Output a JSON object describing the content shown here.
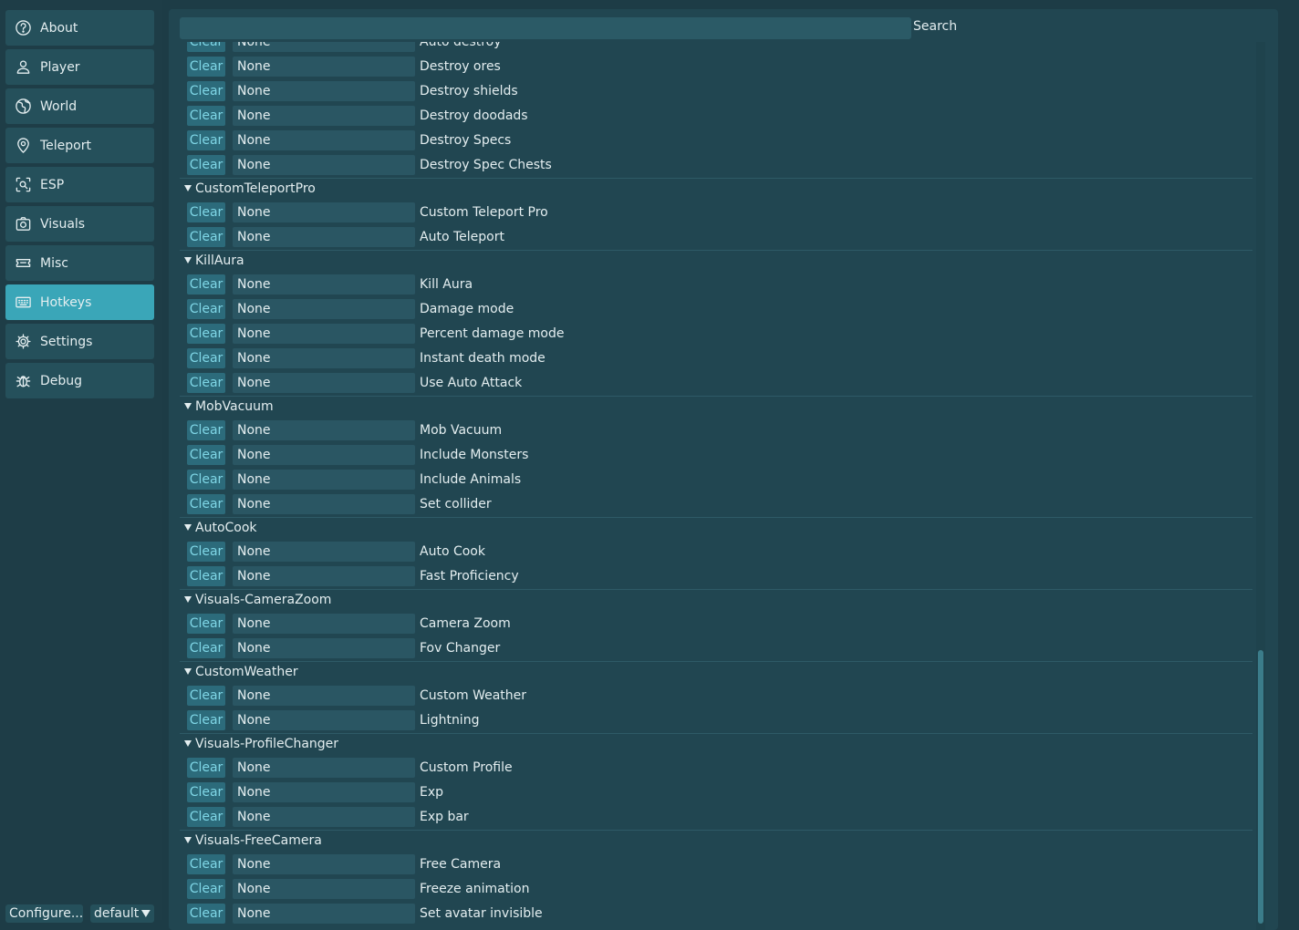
{
  "sidebar": {
    "items": [
      {
        "label": "About",
        "icon": "help-circle-icon"
      },
      {
        "label": "Player",
        "icon": "user-icon"
      },
      {
        "label": "World",
        "icon": "globe-icon"
      },
      {
        "label": "Teleport",
        "icon": "map-pin-icon"
      },
      {
        "label": "ESP",
        "icon": "scan-icon"
      },
      {
        "label": "Visuals",
        "icon": "camera-icon"
      },
      {
        "label": "Misc",
        "icon": "ticket-icon"
      },
      {
        "label": "Hotkeys",
        "icon": "keyboard-icon",
        "active": true
      },
      {
        "label": "Settings",
        "icon": "gear-icon"
      },
      {
        "label": "Debug",
        "icon": "bug-icon"
      }
    ],
    "footer": {
      "config_label": "Configure...",
      "profile_label": "default"
    }
  },
  "search": {
    "label": "Search",
    "value": ""
  },
  "colors": {
    "background": "#1d3c46",
    "panel": "#214651",
    "accent": "#3aa6b8",
    "clear_text": "#7fd6e6"
  },
  "hotkeys": {
    "clear_label": "Clear",
    "partial_top": {
      "key": "None",
      "label": "Auto destroy"
    },
    "groups": [
      {
        "title": null,
        "items": [
          {
            "key": "None",
            "label": "Destroy ores"
          },
          {
            "key": "None",
            "label": "Destroy shields"
          },
          {
            "key": "None",
            "label": "Destroy doodads"
          },
          {
            "key": "None",
            "label": "Destroy Specs"
          },
          {
            "key": "None",
            "label": "Destroy Spec Chests"
          }
        ]
      },
      {
        "title": "CustomTeleportPro",
        "items": [
          {
            "key": "None",
            "label": "Custom Teleport Pro"
          },
          {
            "key": "None",
            "label": "Auto Teleport"
          }
        ]
      },
      {
        "title": "KillAura",
        "items": [
          {
            "key": "None",
            "label": "Kill Aura"
          },
          {
            "key": "None",
            "label": "Damage mode"
          },
          {
            "key": "None",
            "label": "Percent damage mode"
          },
          {
            "key": "None",
            "label": "Instant death mode"
          },
          {
            "key": "None",
            "label": "Use Auto Attack"
          }
        ]
      },
      {
        "title": "MobVacuum",
        "items": [
          {
            "key": "None",
            "label": "Mob Vacuum"
          },
          {
            "key": "None",
            "label": "Include Monsters"
          },
          {
            "key": "None",
            "label": "Include Animals"
          },
          {
            "key": "None",
            "label": "Set collider"
          }
        ]
      },
      {
        "title": "AutoCook",
        "items": [
          {
            "key": "None",
            "label": "Auto Cook"
          },
          {
            "key": "None",
            "label": "Fast Proficiency"
          }
        ]
      },
      {
        "title": "Visuals-CameraZoom",
        "items": [
          {
            "key": "None",
            "label": "Camera Zoom"
          },
          {
            "key": "None",
            "label": "Fov Changer"
          }
        ]
      },
      {
        "title": "CustomWeather",
        "items": [
          {
            "key": "None",
            "label": "Custom Weather"
          },
          {
            "key": "None",
            "label": "Lightning"
          }
        ]
      },
      {
        "title": "Visuals-ProfileChanger",
        "items": [
          {
            "key": "None",
            "label": "Custom Profile"
          },
          {
            "key": "None",
            "label": "Exp"
          },
          {
            "key": "None",
            "label": "Exp bar"
          }
        ]
      },
      {
        "title": "Visuals-FreeCamera",
        "items": [
          {
            "key": "None",
            "label": "Free Camera"
          },
          {
            "key": "None",
            "label": "Freeze animation"
          },
          {
            "key": "None",
            "label": "Set avatar invisible"
          }
        ]
      }
    ]
  }
}
